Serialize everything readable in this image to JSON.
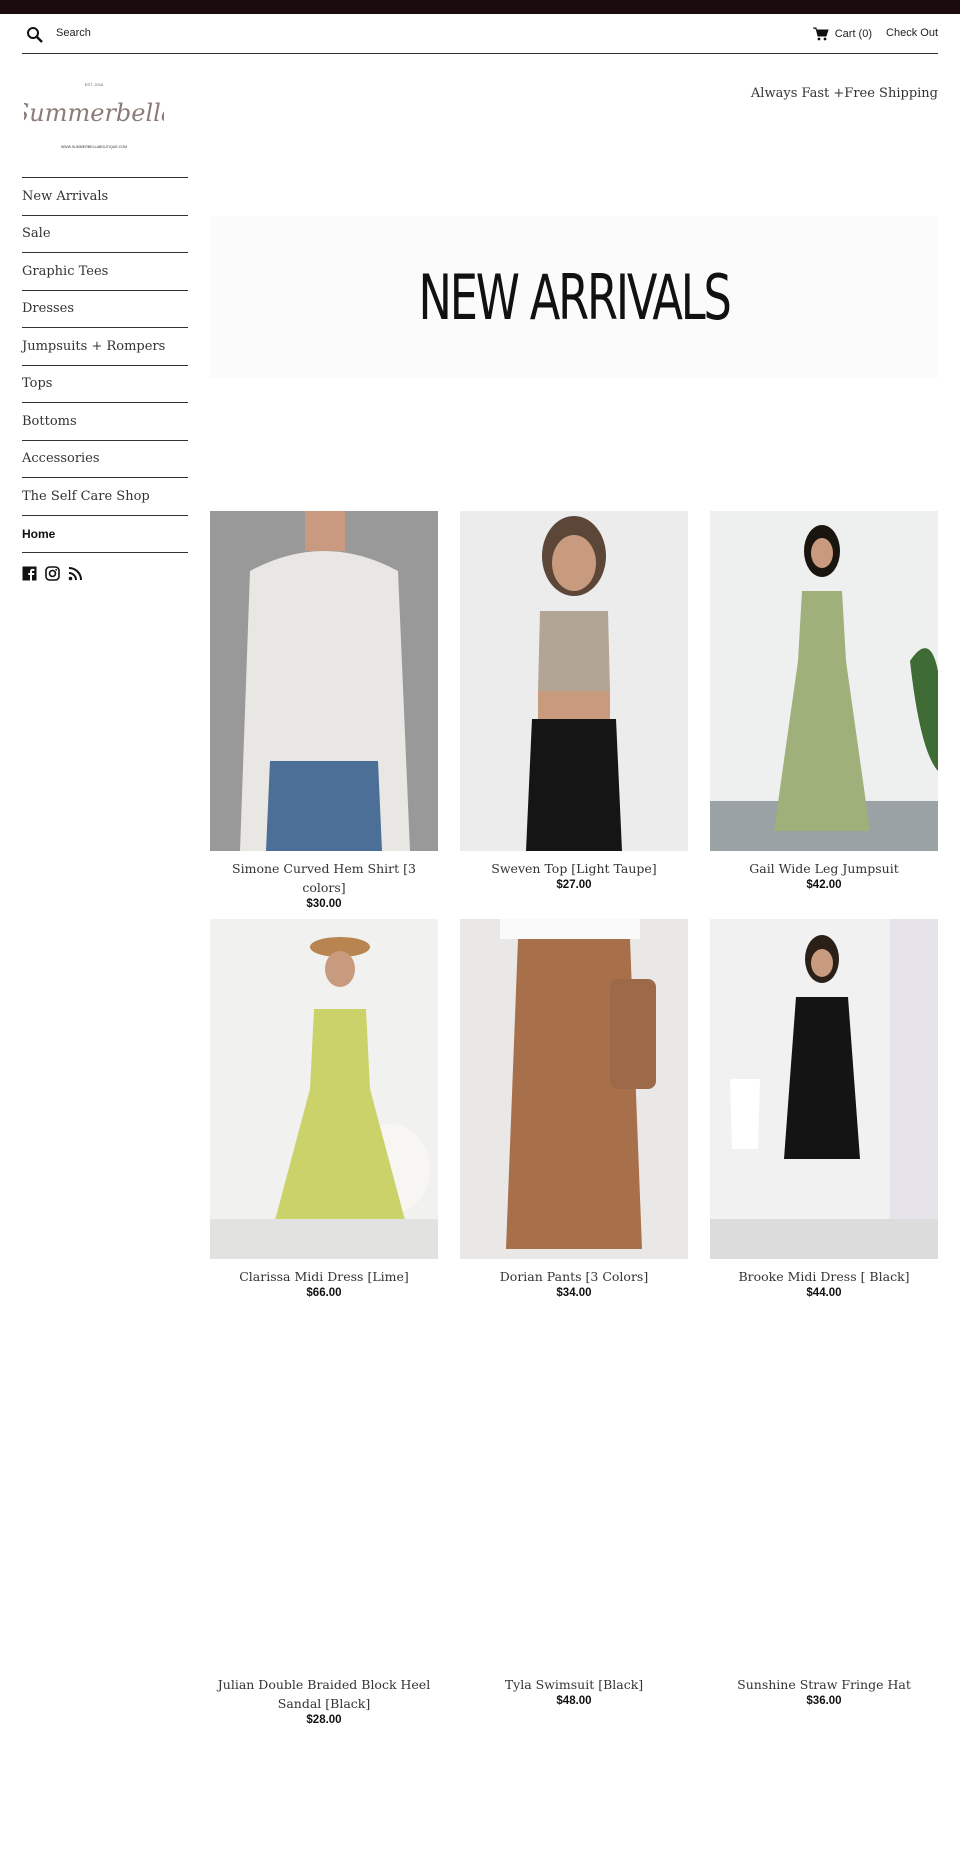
{
  "header": {
    "search_label": "Search",
    "cart_label": "Cart (0)",
    "checkout_label": "Check Out",
    "shipping_text": "Always Fast +Free Shipping"
  },
  "logo": {
    "est": "EST. 2018",
    "name": "Summerbella",
    "url": "WWW.SUMMERBELLABOUTIQUE.COM"
  },
  "nav": {
    "items": [
      {
        "label": "New Arrivals"
      },
      {
        "label": "Sale"
      },
      {
        "label": "Graphic Tees"
      },
      {
        "label": "Dresses"
      },
      {
        "label": "Jumpsuits + Rompers"
      },
      {
        "label": "Tops"
      },
      {
        "label": "Bottoms"
      },
      {
        "label": "Accessories"
      },
      {
        "label": "The Self Care Shop"
      },
      {
        "label": "Home"
      }
    ]
  },
  "social": [
    "facebook-icon",
    "instagram-icon",
    "rss-icon"
  ],
  "banner": {
    "text": "NEW ARRIVALS"
  },
  "products": [
    {
      "name": "Simone Curved Hem Shirt [3 colors]",
      "price": "$30.00"
    },
    {
      "name": "Sweven Top [Light Taupe]",
      "price": "$27.00"
    },
    {
      "name": "Gail Wide Leg Jumpsuit",
      "price": "$42.00"
    },
    {
      "name": "Clarissa Midi Dress [Lime]",
      "price": "$66.00"
    },
    {
      "name": "Dorian Pants [3 Colors]",
      "price": "$34.00"
    },
    {
      "name": "Brooke Midi Dress [ Black]",
      "price": "$44.00"
    },
    {
      "name": "Julian Double Braided Block Heel Sandal [Black]",
      "price": "$28.00"
    },
    {
      "name": "Tyla Swimsuit [Black]",
      "price": "$48.00"
    },
    {
      "name": "Sunshine Straw Fringe Hat",
      "price": "$36.00"
    }
  ]
}
